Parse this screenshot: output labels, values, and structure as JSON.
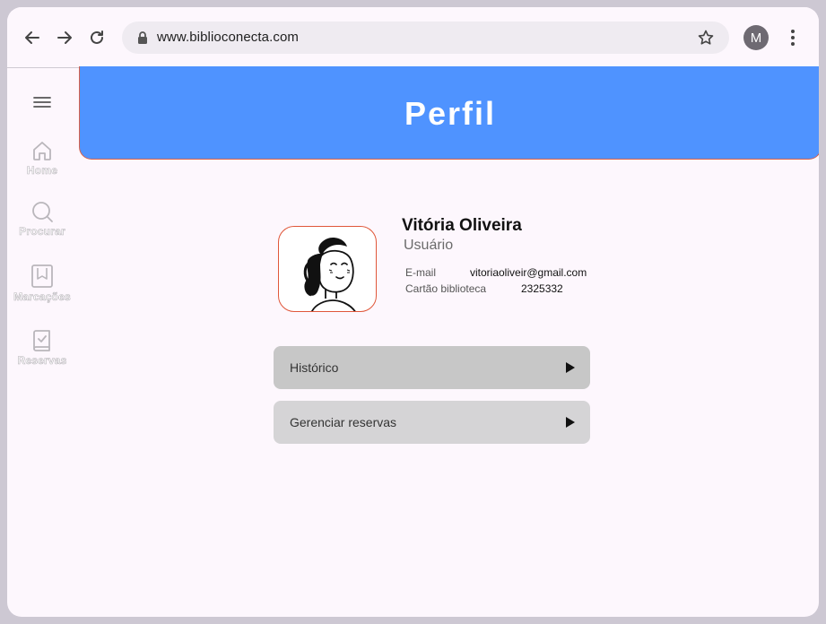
{
  "browser": {
    "url": "www.biblioconecta.com",
    "profile_initial": "M"
  },
  "sidebar": {
    "items": [
      {
        "label": "Home",
        "icon": "home-icon"
      },
      {
        "label": "Procurar",
        "icon": "search-icon"
      },
      {
        "label": "Marcações",
        "icon": "bookmark-icon"
      },
      {
        "label": "Reservas",
        "icon": "reservation-book-icon"
      }
    ]
  },
  "header": {
    "title": "Perfil"
  },
  "profile": {
    "name": "Vitória Oliveira",
    "role": "Usuário",
    "email_label": "E-mail",
    "email": "vitoriaoliveir@gmail.com",
    "card_label": "Cartão biblioteca",
    "card_number": "2325332"
  },
  "actions": [
    {
      "label": "Histórico"
    },
    {
      "label": "Gerenciar reservas"
    }
  ],
  "colors": {
    "banner": "#4f93ff",
    "banner_border": "#d9624a",
    "page_bg": "#fdf7fd",
    "action_1_bg": "#c7c7c7",
    "action_2_bg": "#d5d4d6"
  }
}
